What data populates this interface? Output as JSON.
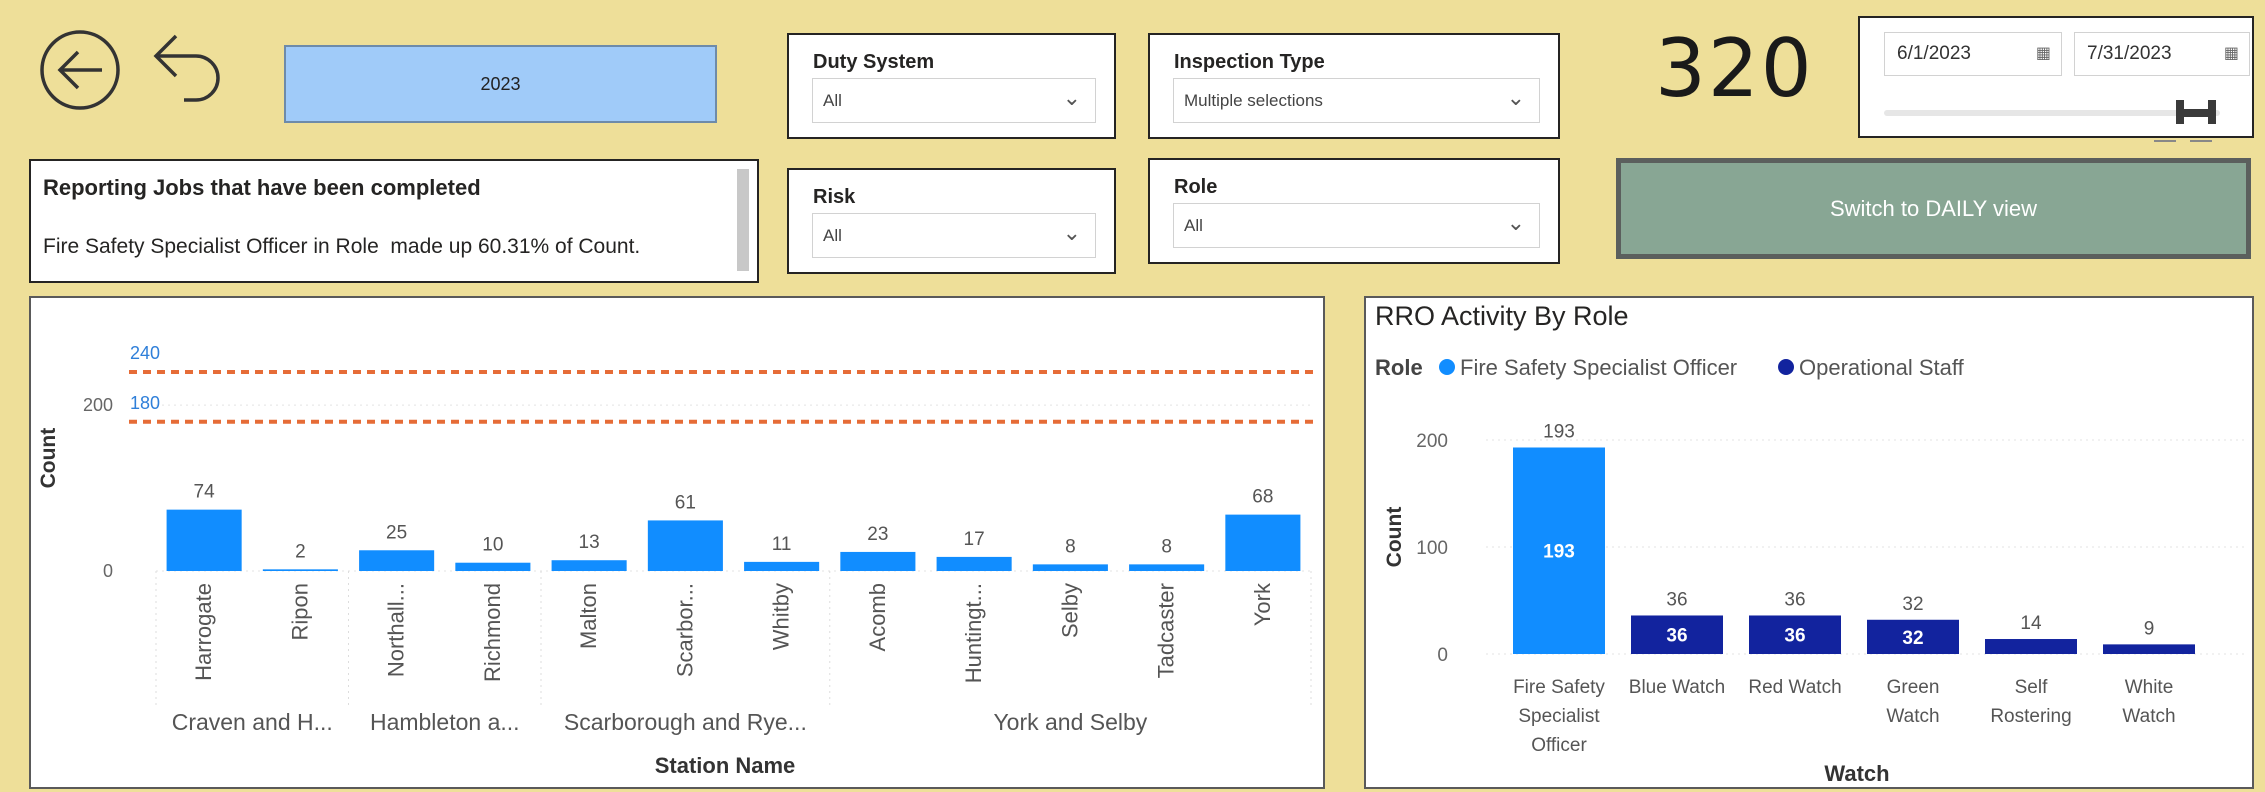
{
  "header": {
    "year_button": "2023",
    "kpi_value": "320",
    "date_start": "6/1/2023",
    "date_end": "7/31/2023",
    "switch_button": "Switch to DAILY view"
  },
  "slicers": {
    "duty_system": {
      "title": "Duty System",
      "value": "All"
    },
    "inspection_type": {
      "title": "Inspection Type",
      "value": "Multiple selections"
    },
    "risk": {
      "title": "Risk",
      "value": "All"
    },
    "role": {
      "title": "Role",
      "value": "All"
    }
  },
  "textbox": {
    "title": "Reporting Jobs that have been completed",
    "body": "Fire Safety Specialist Officer in Role  made up 60.31% of Count."
  },
  "colors": {
    "background": "#EEDF99",
    "bar_light": "#118DFF",
    "bar_dark": "#12239E",
    "ref_line": "#E66C37",
    "switch_button": "#88A694"
  },
  "chart_data": [
    {
      "type": "bar",
      "title": "",
      "xlabel": "Station Name",
      "ylabel": "Count",
      "ylim": [
        0,
        260
      ],
      "yticks": [
        0,
        200
      ],
      "reference_lines": [
        {
          "value": 240,
          "label": "240"
        },
        {
          "value": 180,
          "label": "180"
        }
      ],
      "categories": [
        "Harrogate",
        "Ripon",
        "Northall...",
        "Richmond",
        "Malton",
        "Scarbor...",
        "Whitby",
        "Acomb",
        "Huntingt...",
        "Selby",
        "Tadcaster",
        "York"
      ],
      "values": [
        74,
        2,
        25,
        10,
        13,
        61,
        11,
        23,
        17,
        8,
        8,
        68
      ],
      "groups": [
        {
          "label": "Craven and H...",
          "count": 2
        },
        {
          "label": "Hambleton a...",
          "count": 2
        },
        {
          "label": "Scarborough and Rye...",
          "count": 3
        },
        {
          "label": "York and Selby",
          "count": 5
        }
      ]
    },
    {
      "type": "bar",
      "title": "RRO Activity By Role",
      "legend_title": "Role",
      "legend": "top-left",
      "xlabel": "Watch",
      "ylabel": "Count",
      "ylim": [
        0,
        220
      ],
      "yticks": [
        0,
        100,
        200
      ],
      "categories": [
        "Fire Safety Specialist Officer",
        "Blue Watch",
        "Red Watch",
        "Green Watch",
        "Self Rostering",
        "White Watch"
      ],
      "category_lines": [
        [
          "Fire Safety",
          "Specialist",
          "Officer"
        ],
        [
          "Blue Watch"
        ],
        [
          "Red Watch"
        ],
        [
          "Green",
          "Watch"
        ],
        [
          "Self",
          "Rostering"
        ],
        [
          "White",
          "Watch"
        ]
      ],
      "series": [
        {
          "name": "Fire Safety Specialist Officer",
          "values": [
            193,
            null,
            null,
            null,
            null,
            null
          ]
        },
        {
          "name": "Operational Staff",
          "values": [
            null,
            36,
            36,
            32,
            14,
            9
          ]
        }
      ],
      "inner_labels": [
        "193",
        "36",
        "36",
        "32",
        "",
        ""
      ]
    }
  ]
}
